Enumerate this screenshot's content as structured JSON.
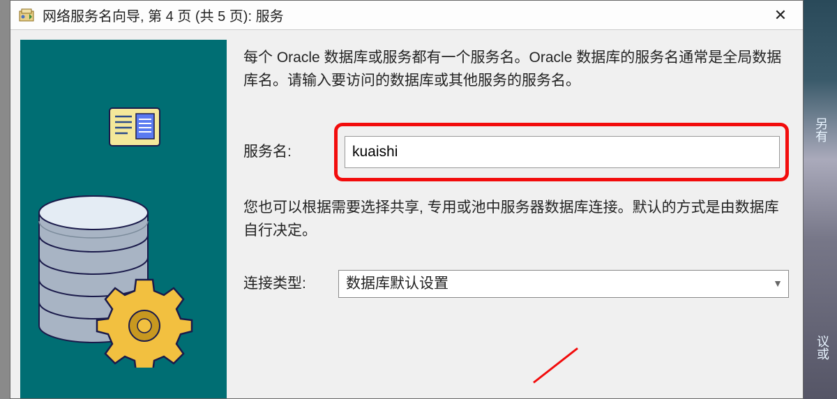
{
  "titlebar": {
    "title": "网络服务名向导, 第 4 页 (共 5 页): 服务"
  },
  "main": {
    "description1": "每个 Oracle 数据库或服务都有一个服务名。Oracle 数据库的服务名通常是全局数据库名。请输入要访问的数据库或其他服务的服务名。",
    "service_name_label": "服务名:",
    "service_name_value": "kuaishi",
    "description2": "您也可以根据需要选择共享, 专用或池中服务器数据库连接。默认的方式是由数据库自行决定。",
    "connection_type_label": "连接类型:",
    "connection_type_value": "数据库默认设置"
  },
  "side": {
    "txt1": "另有",
    "txt2": "议或"
  }
}
